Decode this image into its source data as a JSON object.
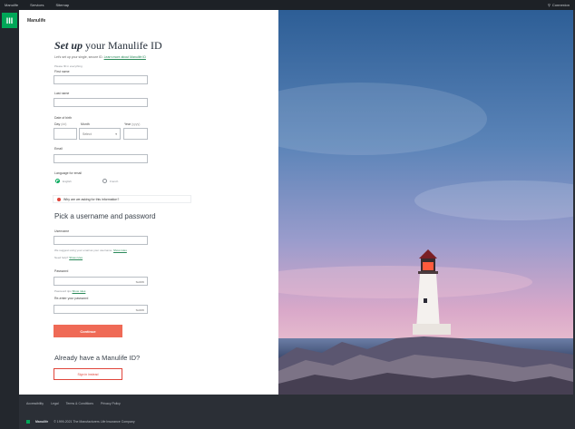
{
  "topbar": {
    "items": [
      "Manulife",
      "Services",
      "Sitemap"
    ],
    "right_label": "Connexion"
  },
  "brand": {
    "name": "Manulife",
    "logo_glyph": "III"
  },
  "form": {
    "title_italic": "Set up",
    "title_rest": "your Manulife ID",
    "intro_text": "Let's set up your single, secure ID.",
    "intro_link": "Learn more about Manulife ID",
    "required_note": "Please fill in everything",
    "first_name_label": "First name",
    "last_name_label": "Last name",
    "dob_label": "Date of birth",
    "day_label": "Day",
    "day_hint": "(dd)",
    "month_label": "Month",
    "month_value": "Select",
    "year_label": "Year",
    "year_hint": "(yyyy)",
    "email_label": "Email",
    "language_label": "Language for email",
    "language_options": [
      "English",
      "French"
    ],
    "info_text": "Why are we asking for this information?",
    "section2_title": "Pick a username and password",
    "username_label": "Username",
    "username_hint_text": "We suggest using your email as your username.",
    "username_hint_link": "Show rules",
    "username_forgot_text": "Need help?",
    "username_forgot_link": "Show rules",
    "password_label": "Password",
    "password_show": "SHOW",
    "password_hint_text": "Password tips",
    "password_hint_link": "Show rules",
    "reenter_label": "Re-enter your password",
    "reenter_show": "SHOW",
    "continue_label": "Continue",
    "already_title": "Already have a Manulife ID?",
    "signin_label": "Sign in instead"
  },
  "footer": {
    "links": [
      "Accessibility",
      "Legal",
      "Terms & Conditions",
      "Privacy Policy"
    ],
    "brand": "Manulife",
    "copyright": "© 1999-2021 The Manufacturers Life Insurance Company"
  },
  "colors": {
    "accent": "#00a758",
    "cta": "#ef6a56",
    "danger": "#e0453a"
  }
}
